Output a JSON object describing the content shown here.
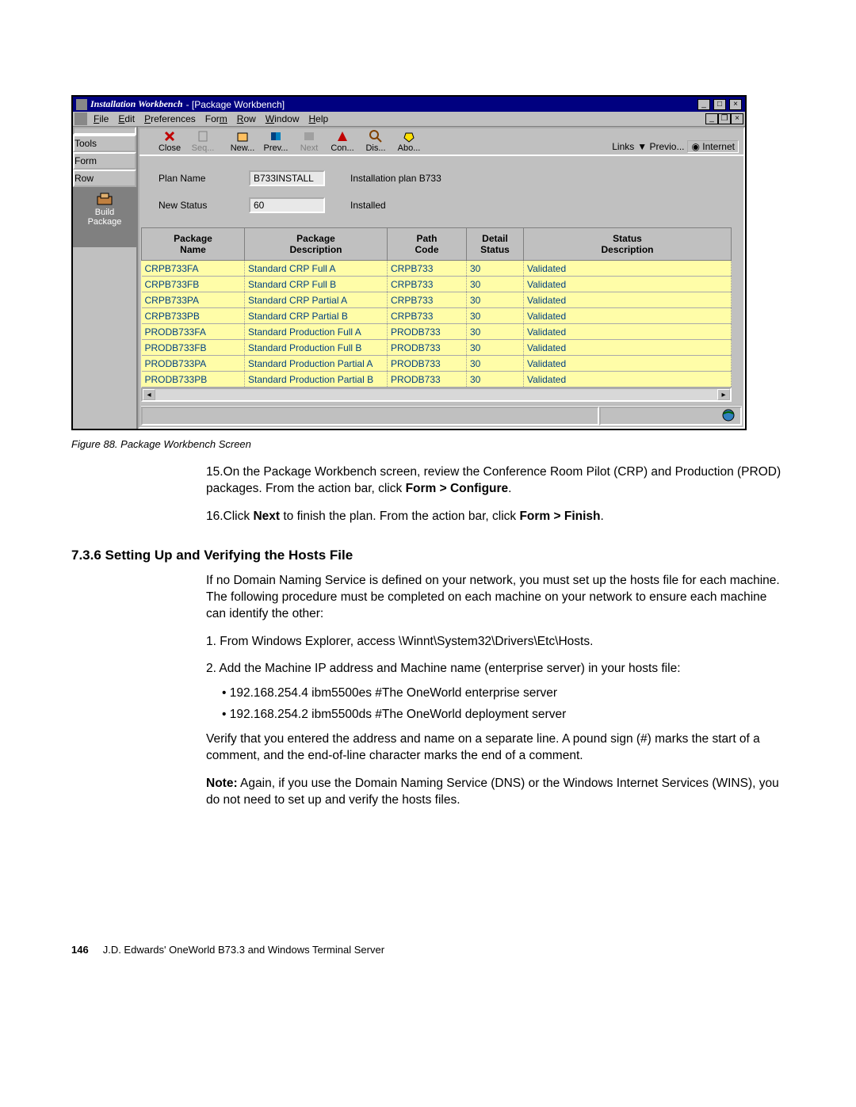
{
  "window": {
    "title_app": "Installation Workbench",
    "title_sep": " - [Package Workbench]",
    "menus": [
      "File",
      "Edit",
      "Preferences",
      "Form",
      "Row",
      "Window",
      "Help"
    ]
  },
  "sidebar": {
    "tabs": [
      "Tools",
      "Form",
      "Row"
    ],
    "selected_label_top": "Build",
    "selected_label_bottom": "Package"
  },
  "toolbar": {
    "items": [
      {
        "label": "Close",
        "dis": false
      },
      {
        "label": "Seq...",
        "dis": true
      },
      {
        "label": "New...",
        "dis": false
      },
      {
        "label": "Prev...",
        "dis": false
      },
      {
        "label": "Next",
        "dis": true
      },
      {
        "label": "Con...",
        "dis": false
      },
      {
        "label": "Dis...",
        "dis": false
      },
      {
        "label": "Abo...",
        "dis": false
      }
    ],
    "links_label": "Links",
    "dropdown": "Previo...",
    "internet": "Internet"
  },
  "form": {
    "plan_label": "Plan Name",
    "plan_value": "B733INSTALL",
    "plan_desc": "Installation plan B733",
    "status_label": "New Status",
    "status_value": "60",
    "status_desc": "Installed"
  },
  "grid": {
    "headers": [
      "Package\nName",
      "Package\nDescription",
      "Path\nCode",
      "Detail\nStatus",
      "Status\nDescription"
    ],
    "rows": [
      [
        "CRPB733FA",
        "Standard CRP Full  A",
        "CRPB733",
        "30",
        "Validated"
      ],
      [
        "CRPB733FB",
        "Standard CRP Full  B",
        "CRPB733",
        "30",
        "Validated"
      ],
      [
        "CRPB733PA",
        "Standard CRP Partial  A",
        "CRPB733",
        "30",
        "Validated"
      ],
      [
        "CRPB733PB",
        "Standard CRP Partial  B",
        "CRPB733",
        "30",
        "Validated"
      ],
      [
        "PRODB733FA",
        "Standard Production Full  A",
        "PRODB733",
        "30",
        "Validated"
      ],
      [
        "PRODB733FB",
        "Standard Production Full  B",
        "PRODB733",
        "30",
        "Validated"
      ],
      [
        "PRODB733PA",
        "Standard Production Partial  A",
        "PRODB733",
        "30",
        "Validated"
      ],
      [
        "PRODB733PB",
        "Standard Production Partial  B",
        "PRODB733",
        "30",
        "Validated"
      ]
    ]
  },
  "caption": "Figure 88.  Package Workbench Screen",
  "step15_a": "15.On the Package Workbench screen, review the Conference Room Pilot (CRP) and Production (PROD) packages. From the action bar, click ",
  "step15_b": "Form > Configure",
  "step15_c": ".",
  "step16_a": "16.Click ",
  "step16_b": "Next",
  "step16_c": " to finish the plan. From the action bar, click ",
  "step16_d": "Form > Finish",
  "step16_e": ".",
  "section": "7.3.6  Setting Up and Verifying the Hosts File",
  "para1": "If no Domain Naming Service is defined on your network, you must set up the hosts file for each machine. The following procedure must be completed on each machine on your network to ensure each machine can identify the other:",
  "ol1_a": "1.  From Windows Explorer, access \\Winnt\\System32\\Drivers\\Etc\\Hosts.",
  "ol2_a": "2.  Add the Machine IP address and Machine name (enterprise server) in your hosts file:",
  "b1": "192.168.254.4 ibm5500es #The OneWorld enterprise server",
  "b2": "192.168.254.2 ibm5500ds #The OneWorld deployment server",
  "para2": "Verify that you entered the address and name on a separate line. A pound sign (#) marks the start of a comment, and the end-of-line character marks the end of a comment.",
  "note_b": "Note:",
  "note_t": " Again, if you use the Domain Naming Service (DNS) or the Windows Internet Services (WINS), you do not need to set up and verify the hosts files.",
  "footer_page": "146",
  "footer_text": "J.D. Edwards' OneWorld B73.3 and Windows Terminal Server"
}
